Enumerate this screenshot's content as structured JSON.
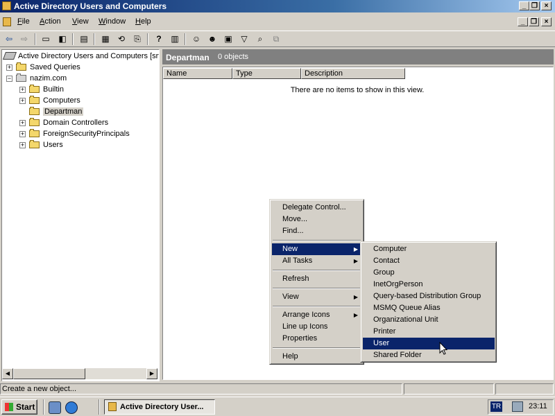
{
  "window": {
    "title": "Active Directory Users and Computers",
    "minimize_glyph": "_",
    "maximize_glyph": "❐",
    "close_glyph": "×"
  },
  "menubar": {
    "items": [
      {
        "label": "File",
        "key": "F",
        "rest": "ile"
      },
      {
        "label": "Action",
        "key": "A",
        "rest": "ction"
      },
      {
        "label": "View",
        "key": "V",
        "rest": "iew"
      },
      {
        "label": "Window",
        "key": "W",
        "rest": "indow"
      },
      {
        "label": "Help",
        "key": "H",
        "rest": "elp"
      }
    ]
  },
  "toolbar": {
    "icons": [
      "back-arrow-icon",
      "forward-arrow-icon",
      "up-folder-icon",
      "show-hide-tree-icon",
      "delete-icon",
      "properties-icon",
      "refresh-icon",
      "export-list-icon",
      "help-icon",
      "console-icon",
      "new-user-icon",
      "new-group-icon",
      "new-ou-icon",
      "filter-icon",
      "find-icon",
      "add-to-group-icon"
    ],
    "glyphs": {
      "back": "⇦",
      "forward": "⇨",
      "up": "▭",
      "tree": "◧",
      "delete": "▤",
      "props": "▦",
      "refresh": "⟲",
      "export": "⎘",
      "help": "?",
      "console": "▥",
      "user": "☺",
      "group": "☻",
      "ou": "▣",
      "filter": "▽",
      "find": "⌕",
      "addgroup": "⧉"
    }
  },
  "tree": {
    "root": "Active Directory Users and Computers [srv",
    "nodes": [
      {
        "label": "Saved Queries",
        "level": 1,
        "expander": "+"
      },
      {
        "label": "nazim.com",
        "level": 1,
        "expander": "−"
      },
      {
        "label": "Builtin",
        "level": 2,
        "expander": "+"
      },
      {
        "label": "Computers",
        "level": 2,
        "expander": "+"
      },
      {
        "label": "Departman",
        "level": 2,
        "expander": "",
        "selected": true
      },
      {
        "label": "Domain Controllers",
        "level": 2,
        "expander": "+"
      },
      {
        "label": "ForeignSecurityPrincipals",
        "level": 2,
        "expander": "+"
      },
      {
        "label": "Users",
        "level": 2,
        "expander": "+"
      }
    ]
  },
  "scrollbar": {
    "left_glyph": "◀",
    "right_glyph": "▶"
  },
  "details": {
    "title": "Departman",
    "count": "0 objects",
    "columns": [
      "Name",
      "Type",
      "Description"
    ],
    "empty_message": "There are no items to show in this view."
  },
  "context_menu": {
    "items": [
      {
        "label": "Delegate Control..."
      },
      {
        "label": "Move..."
      },
      {
        "label": "Find..."
      },
      {
        "label": "New",
        "submenu": true,
        "highlighted": true
      },
      {
        "label": "All Tasks",
        "submenu": true
      },
      {
        "label": "Refresh"
      },
      {
        "label": "View",
        "submenu": true
      },
      {
        "label": "Arrange Icons",
        "submenu": true
      },
      {
        "label": "Line up Icons"
      },
      {
        "label": "Properties"
      },
      {
        "label": "Help"
      }
    ],
    "submenu_arrow": "▶"
  },
  "new_submenu": {
    "items": [
      {
        "label": "Computer"
      },
      {
        "label": "Contact"
      },
      {
        "label": "Group"
      },
      {
        "label": "InetOrgPerson"
      },
      {
        "label": "Query-based Distribution Group"
      },
      {
        "label": "MSMQ Queue Alias"
      },
      {
        "label": "Organizational Unit"
      },
      {
        "label": "Printer"
      },
      {
        "label": "User",
        "highlighted": true
      },
      {
        "label": "Shared Folder"
      }
    ]
  },
  "statusbar": {
    "text": "Create a new object..."
  },
  "taskbar": {
    "start_label": "Start",
    "task_label": "Active Directory User...",
    "language": "TR",
    "clock": "23:11"
  }
}
